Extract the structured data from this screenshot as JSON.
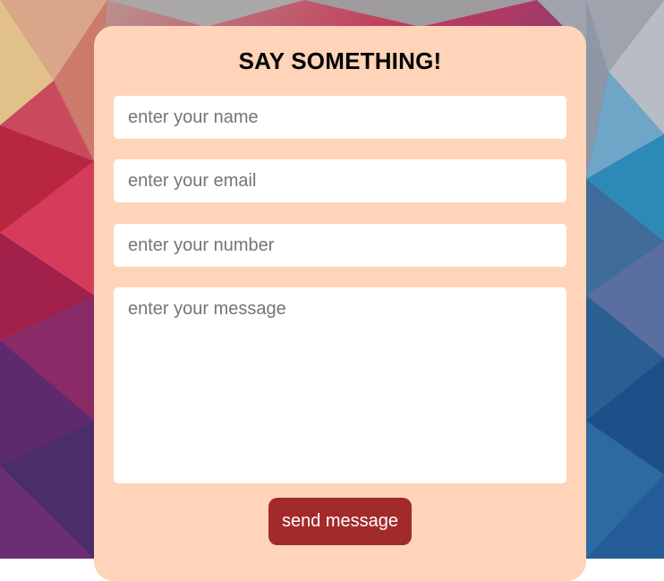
{
  "form": {
    "title": "SAY SOMETHING!",
    "name_placeholder": "enter your name",
    "email_placeholder": "enter your email",
    "number_placeholder": "enter your number",
    "message_placeholder": "enter your message",
    "send_label": "send message"
  },
  "colors": {
    "card_background": "#ffd4b8",
    "button_background": "#a32a2a",
    "button_text": "#ffffff"
  }
}
